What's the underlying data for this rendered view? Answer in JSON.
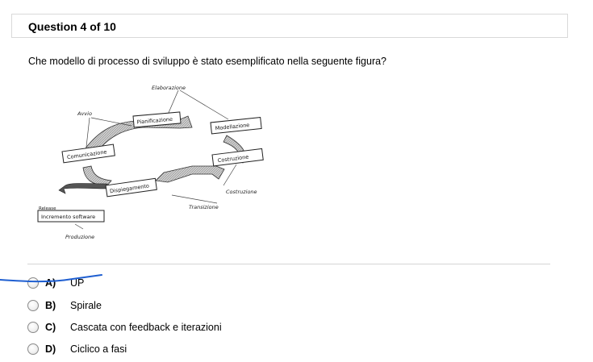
{
  "header": {
    "title": "Question 4 of 10"
  },
  "question": {
    "text": "Che modello di processo di sviluppo è stato esemplificato nella seguente figura?"
  },
  "figure": {
    "labels": {
      "elaborazione": "Elaborazione",
      "avvio": "Avvio",
      "pianificazione": "Pianificazione",
      "modellazione": "Modellazione",
      "comunicazione": "Comunicazione",
      "costruzione_box": "Costruzione",
      "costruzione_phase": "Costruzione",
      "dispiegamento": "Dispiegamento",
      "transizione": "Transizione",
      "release": "Release",
      "incremento": "Incremento software",
      "produzione": "Produzione"
    }
  },
  "answers": [
    {
      "letter": "A)",
      "text": "UP"
    },
    {
      "letter": "B)",
      "text": "Spirale"
    },
    {
      "letter": "C)",
      "text": "Cascata con feedback e iterazioni"
    },
    {
      "letter": "D)",
      "text": "Ciclico a fasi"
    }
  ],
  "annotation": {
    "pen_color": "#1f5fd1"
  }
}
